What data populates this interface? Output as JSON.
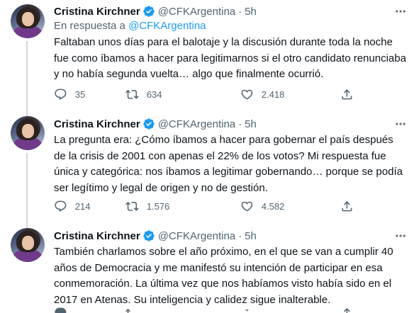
{
  "tweets": [
    {
      "author_name": "Cristina Kirchner",
      "handle": "@CFKArgentina",
      "separator": "·",
      "time": "5h",
      "reply_prefix": "En respuesta a",
      "reply_handle": "@CFKArgentina",
      "text": "Faltaban unos días para el balotaje y la discusión durante toda la noche fue como íbamos a hacer para legitimarnos si el otro candidato renunciaba y no había segunda vuelta… algo que finalmente ocurrió.",
      "replies": "35",
      "retweets": "634",
      "likes": "2.418"
    },
    {
      "author_name": "Cristina Kirchner",
      "handle": "@CFKArgentina",
      "separator": "·",
      "time": "5h",
      "text": "La pregunta era: ¿Cómo íbamos a hacer para gobernar el país después de la crisis de 2001 con apenas el 22% de los votos? Mi respuesta fue única y categórica: nos íbamos a legitimar gobernando… porque se podía ser legítimo y legal de origen y no de gestión.",
      "replies": "214",
      "retweets": "1.576",
      "likes": "4.582"
    },
    {
      "author_name": "Cristina Kirchner",
      "handle": "@CFKArgentina",
      "separator": "·",
      "time": "5h",
      "text": "También charlamos sobre el año próximo, en el que se van a cumplir 40 años de Democracia y me manifestó su intención de participar en esa conmemoración. La última vez que nos habíamos visto había sido en el 2017 en Atenas. Su inteligencia y calidez sigue inalterable.",
      "replies": "",
      "retweets": "",
      "likes": ""
    }
  ],
  "icons": {
    "verified": "verified-badge-icon",
    "more": "more-options-icon",
    "reply": "reply-icon",
    "retweet": "retweet-icon",
    "like": "heart-icon",
    "share": "share-icon"
  },
  "colors": {
    "accent": "#1d9bf0",
    "secondary_text": "#536471",
    "primary_text": "#0f1419",
    "divider": "#eff3f4",
    "thread_line": "#cfd9de"
  }
}
